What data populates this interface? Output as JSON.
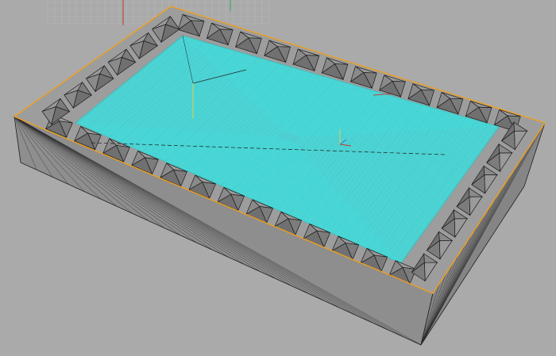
{
  "viewport": {
    "background": "#aaaaaa",
    "grid_color": "#b6b6b6",
    "axis_x_color": "#c0392b",
    "axis_y_color": "#27ae60"
  },
  "model": {
    "box_color": "#8e8e8e",
    "box_top_color": "#9d9d9d",
    "box_side_color": "#8a8a8a",
    "edge_color": "#1b1b1b",
    "selection_color": "#f0a020",
    "toolpath_color": "#3ee0e0",
    "toolpath_bg": "#5fd6d6",
    "pyramid_light": "#9a9a9a",
    "pyramid_dark": "#707070"
  }
}
